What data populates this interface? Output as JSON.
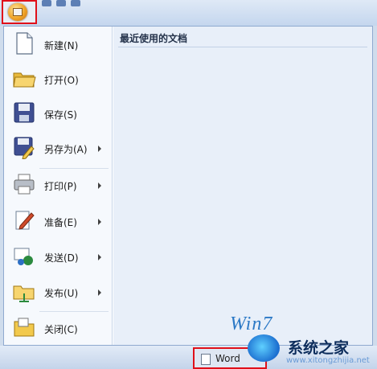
{
  "office_menu": {
    "items": [
      {
        "label": "新建(N)",
        "icon": "new-doc-icon",
        "has_submenu": false
      },
      {
        "label": "打开(O)",
        "icon": "open-folder-icon",
        "has_submenu": false
      },
      {
        "label": "保存(S)",
        "icon": "save-icon",
        "has_submenu": false
      },
      {
        "label": "另存为(A)",
        "icon": "save-as-icon",
        "has_submenu": true
      },
      {
        "label": "打印(P)",
        "icon": "print-icon",
        "has_submenu": true
      },
      {
        "label": "准备(E)",
        "icon": "prepare-icon",
        "has_submenu": true
      },
      {
        "label": "发送(D)",
        "icon": "send-icon",
        "has_submenu": true
      },
      {
        "label": "发布(U)",
        "icon": "publish-icon",
        "has_submenu": true
      },
      {
        "label": "关闭(C)",
        "icon": "close-folder-icon",
        "has_submenu": false
      }
    ],
    "recent_docs_title": "最近使用的文档"
  },
  "taskbar": {
    "word_button_label": "Word"
  },
  "watermark": {
    "brand": "系统之家",
    "url": "www.xitongzhijia.net",
    "win_text": "Win7"
  }
}
